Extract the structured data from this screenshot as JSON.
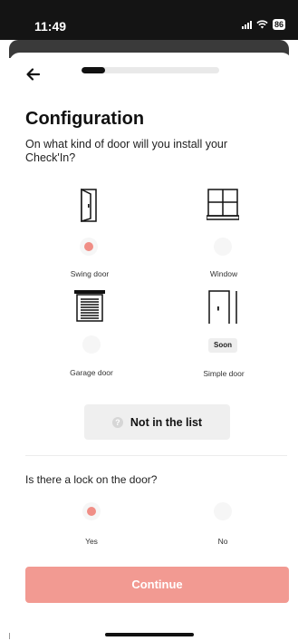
{
  "status_bar": {
    "time": "11:49",
    "battery": "86"
  },
  "progress": {
    "fraction": 0.17
  },
  "header": {
    "title": "Configuration"
  },
  "door_question": "On what kind of door will you install your Check'In?",
  "door_options": [
    {
      "label": "Swing door",
      "icon": "swing-door-icon",
      "selected": true
    },
    {
      "label": "Window",
      "icon": "window-icon",
      "selected": false
    },
    {
      "label": "Garage door",
      "icon": "garage-door-icon",
      "selected": false
    },
    {
      "label": "Simple door",
      "icon": "simple-door-icon",
      "badge": "Soon"
    }
  ],
  "not_in_list": {
    "icon": "?",
    "label": "Not in the list"
  },
  "lock_question": "Is there a lock on the door?",
  "lock_options": [
    {
      "label": "Yes",
      "selected": true
    },
    {
      "label": "No",
      "selected": false
    }
  ],
  "continue_label": "Continue",
  "colors": {
    "accent": "#f08e86",
    "button": "#f29a92",
    "text": "#111111"
  }
}
